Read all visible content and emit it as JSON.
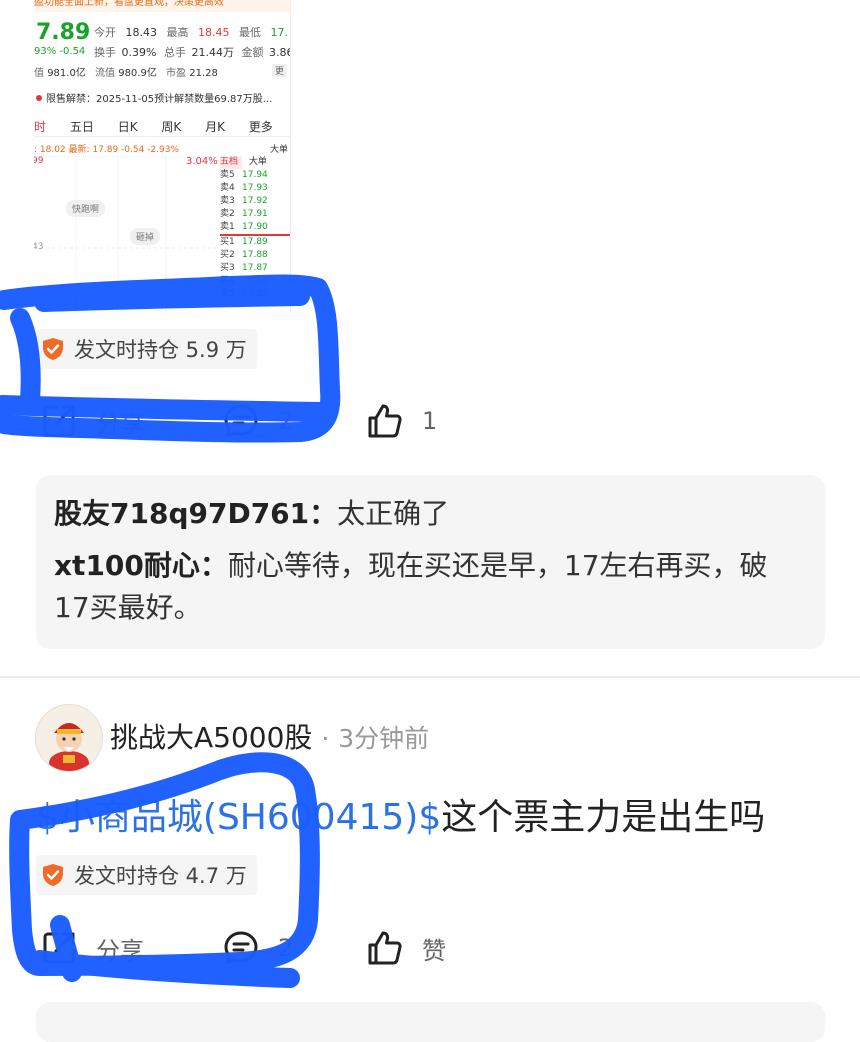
{
  "stock_snapshot": {
    "promo": "盈功能全面上新，看盘更直观，决策更高效",
    "price": "7.89",
    "change_pct": "93%",
    "change_amt": "-0.54",
    "open_label": "今开",
    "open": "18.43",
    "high_label": "最高",
    "high": "18.45",
    "low_label": "最低",
    "low": "17.",
    "turnover_label": "换手",
    "turnover": "0.39%",
    "volume_label": "总手",
    "volume": "21.44万",
    "amount_label": "金额",
    "amount": "3.86",
    "mcap_label": "值",
    "mcap": "981.0亿",
    "float_label": "流值",
    "float_value": "980.9亿",
    "pe_label": "市盈",
    "pe": "21.28",
    "more_short": "更",
    "notice": "限售解禁：2025-11-05预计解禁数量69.87万股...",
    "tabs": [
      "时",
      "五日",
      "日K",
      "周K",
      "月K",
      "更多"
    ],
    "mini_bar": ": 18.02 最新: 17.89  -0.54  -2.93%",
    "big_order": "大单",
    "chart_top_value": "99",
    "chart_pct": "3.04%",
    "chart_low_value": "43",
    "chart_tag1": "快跑啊",
    "chart_tag2": "砸掉",
    "book_header": "五档",
    "book_header2": "大单",
    "asks": [
      {
        "label": "卖5",
        "price": "17.94"
      },
      {
        "label": "卖4",
        "price": "17.93"
      },
      {
        "label": "卖3",
        "price": "17.92"
      },
      {
        "label": "卖2",
        "price": "17.91"
      },
      {
        "label": "卖1",
        "price": "17.90"
      }
    ],
    "bids": [
      {
        "label": "买1",
        "price": "17.89"
      },
      {
        "label": "买2",
        "price": "17.88"
      },
      {
        "label": "买3",
        "price": "17.87"
      },
      {
        "label": "买4",
        "price": "17.86"
      },
      {
        "label": "买5",
        "price": "17.85"
      }
    ]
  },
  "post1": {
    "holding_badge": "发文时持仓 5.9 万",
    "share_label": "分享",
    "comment_count": "2",
    "like_count": "1",
    "comments": [
      {
        "user": "股友718q97D761：",
        "text": "太正确了"
      },
      {
        "user": "xt100耐心：",
        "text": "耐心等待，现在买还是早，17左右再买，破",
        "text2": "17买最好。"
      }
    ]
  },
  "post2": {
    "author": "挑战大A5000股",
    "dot": "·",
    "time": "3分钟前",
    "stock_link": "$小商品城(SH600415)$",
    "text": "这个票主力是出生吗",
    "holding_badge": "发文时持仓 4.7 万",
    "share_label": "分享",
    "comment_count": "2",
    "like_label": "赞"
  },
  "colors": {
    "link_blue": "#2a72e5",
    "marker_blue": "#1a5cff",
    "badge_orange": "#f06a28",
    "stock_red": "#e8353c",
    "stock_green": "#1aa329"
  }
}
